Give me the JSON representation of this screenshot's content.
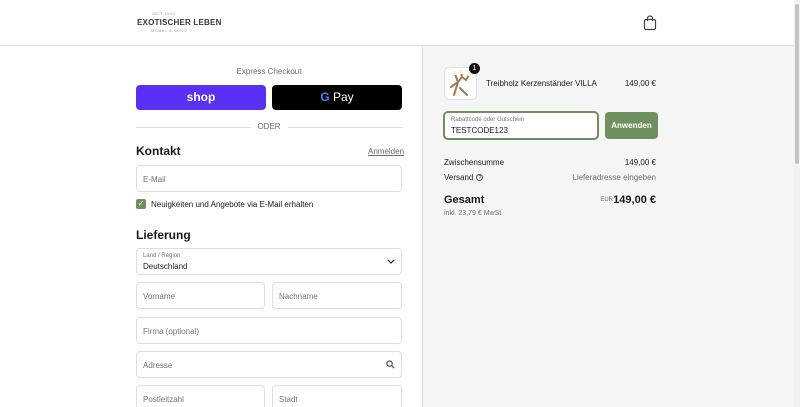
{
  "header": {
    "logo_small": "SEIT 1993",
    "logo_main": "EXOTISCHER LEBEN",
    "logo_sub": "MÖBEL & DEKO"
  },
  "express": {
    "title": "Express Checkout",
    "shop_label": "shop",
    "gpay_g": "G",
    "gpay_label": " Pay",
    "divider": "ODER"
  },
  "contact": {
    "title": "Kontakt",
    "login_link": "Anmelden",
    "email_placeholder": "E-Mail",
    "newsletter_label": "Neuigkeiten und Angebote via E-Mail erhalten",
    "newsletter_checked": true
  },
  "delivery": {
    "title": "Lieferung",
    "country_label": "Land / Region",
    "country_value": "Deutschland",
    "first_name_placeholder": "Vorname",
    "last_name_placeholder": "Nachname",
    "company_placeholder": "Firma (optional)",
    "address_placeholder": "Adresse",
    "zip_placeholder": "Postleitzahl",
    "city_placeholder": "Stadt"
  },
  "summary": {
    "product": {
      "name": "Treibholz Kerzenständer VILLA",
      "price": "149,00 €",
      "quantity": "1"
    },
    "discount_label": "Rabattcode oder Gutschein",
    "discount_value": "TESTCODE123",
    "apply_label": "Anwenden",
    "subtotal_label": "Zwischensumme",
    "subtotal_value": "149,00 €",
    "shipping_label": "Versand",
    "shipping_value": "Lieferadresse eingeben",
    "total_label": "Gesamt",
    "currency": "EUR",
    "total_value": "149,00 €",
    "tax_note": "inkl. 23,79 € MwSt"
  },
  "colors": {
    "accent": "#6f8f5f",
    "shop_pay": "#5a31f4",
    "gpay": "#000000"
  }
}
